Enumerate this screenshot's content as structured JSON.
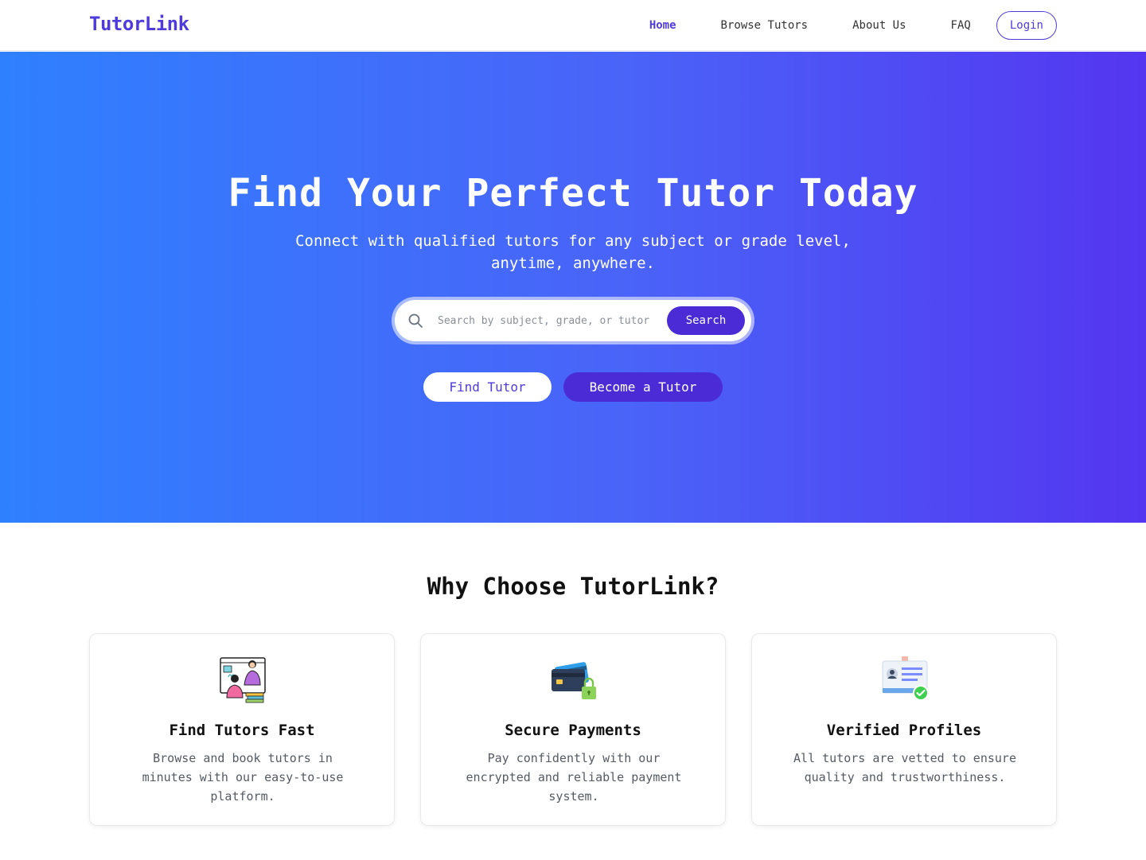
{
  "nav": {
    "logo": "TutorLink",
    "links": [
      "Home",
      "Browse Tutors",
      "About Us",
      "FAQ"
    ],
    "login_label": "Login"
  },
  "hero": {
    "title": "Find Your Perfect Tutor Today",
    "subtitle": "Connect with qualified tutors for any subject or grade level, anytime, anywhere.",
    "search_placeholder": "Search by subject, grade, or tutor",
    "search_button": "Search",
    "find_tutor_button": "Find Tutor",
    "become_tutor_button": "Become a Tutor"
  },
  "features": {
    "title": "Why Choose TutorLink?",
    "cards": [
      {
        "icon": "tutoring-illustration-icon",
        "title": "Find Tutors Fast",
        "description": "Browse and book tutors in minutes with our easy-to-use platform."
      },
      {
        "icon": "credit-card-lock-icon",
        "title": "Secure Payments",
        "description": "Pay confidently with our encrypted and reliable payment system."
      },
      {
        "icon": "verified-id-card-icon",
        "title": "Verified Profiles",
        "description": "All tutors are vetted to ensure quality and trustworthiness."
      }
    ]
  },
  "colors": {
    "brand": "#4f3bdc",
    "button_dark": "#4a2bd6",
    "hero_gradient_start": "#2f80ff",
    "hero_gradient_end": "#5436f0"
  }
}
